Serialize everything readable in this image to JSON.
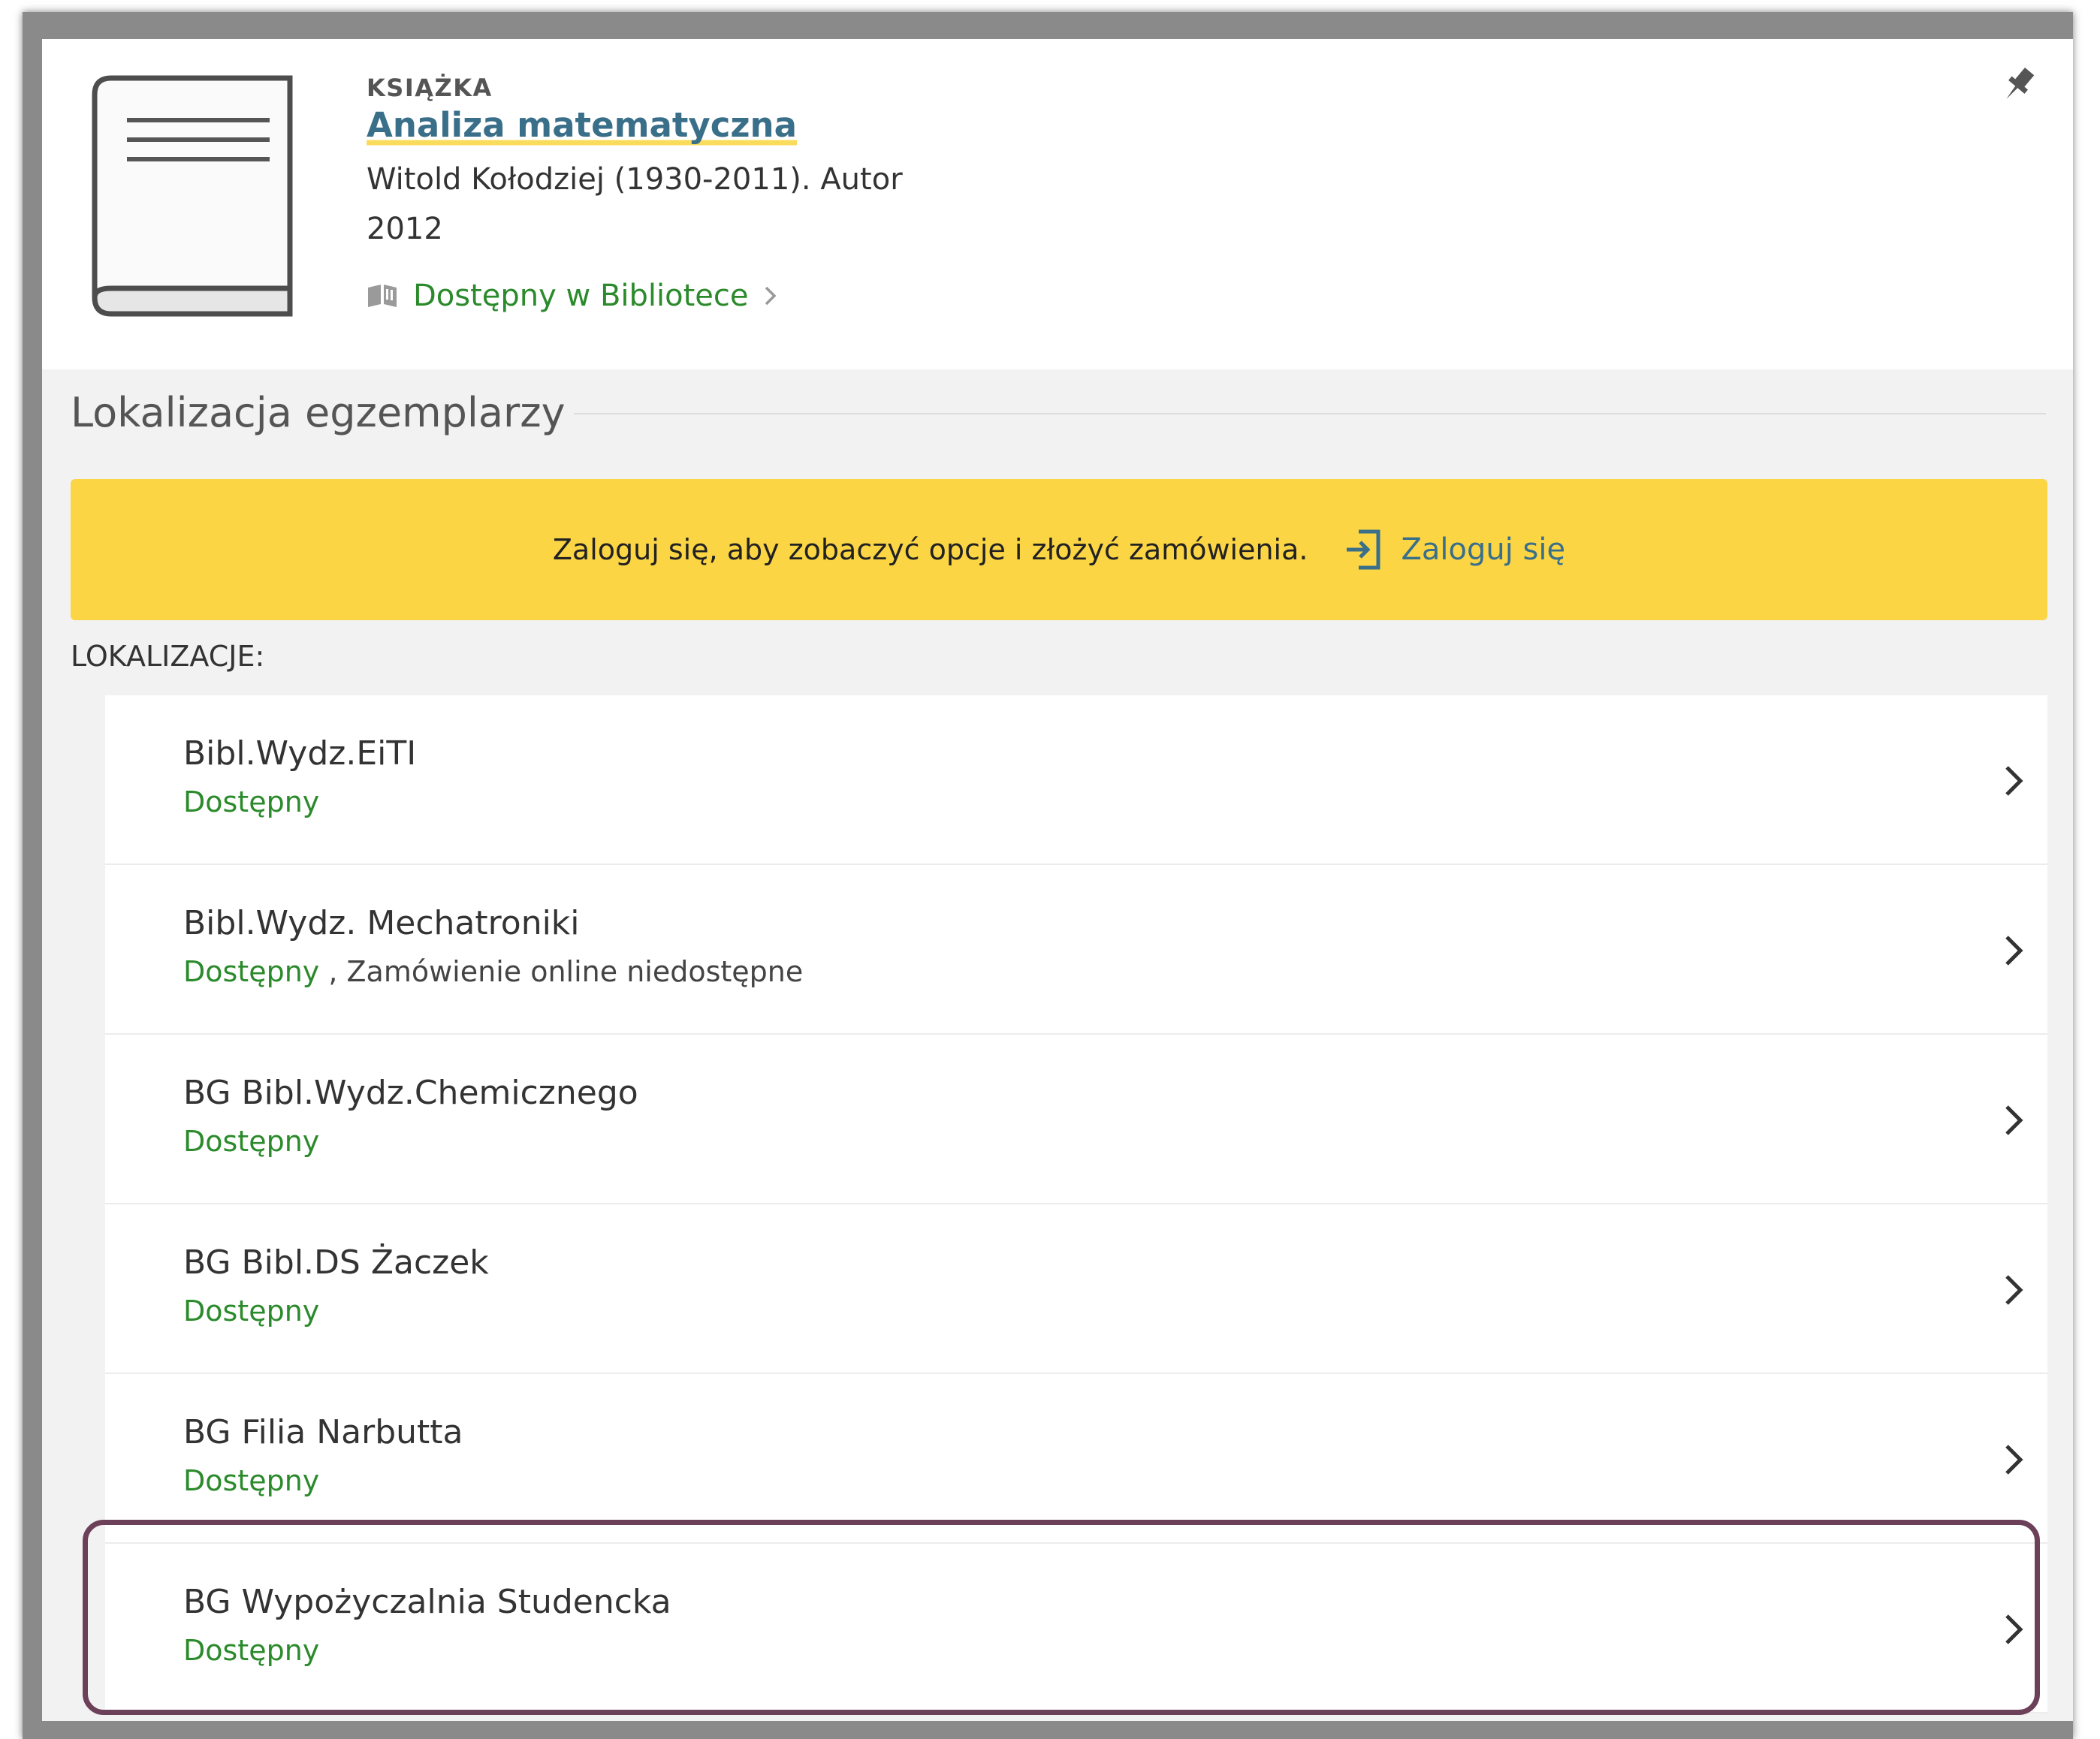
{
  "record": {
    "type": "KSIĄŻKA",
    "title": "Analiza matematyczna",
    "author": "Witold Kołodziej (1930-2011). Autor",
    "year": "2012",
    "availability": "Dostępny w Bibliotece",
    "cover_icon": "book-icon",
    "pin_icon": "pin-icon"
  },
  "section": {
    "title": "Lokalizacja egzemplarzy"
  },
  "banner": {
    "text": "Zaloguj się, aby zobaczyć opcje i złożyć zamówienia.",
    "login_label": "Zaloguj się",
    "login_icon": "sign-in-icon",
    "color": "#fcd545"
  },
  "locations": {
    "heading": "LOKALIZACJE:",
    "items": [
      {
        "name": "Bibl.Wydz.EiTI",
        "status": "Dostępny",
        "note": ""
      },
      {
        "name": "Bibl.Wydz. Mechatroniki",
        "status": "Dostępny",
        "note": " , Zamówienie online niedostępne"
      },
      {
        "name": "BG Bibl.Wydz.Chemicznego",
        "status": "Dostępny",
        "note": ""
      },
      {
        "name": "BG Bibl.DS Żaczek",
        "status": "Dostępny",
        "note": ""
      },
      {
        "name": "BG Filia Narbutta",
        "status": "Dostępny",
        "note": ""
      },
      {
        "name": "BG Wypożyczalnia Studencka",
        "status": "Dostępny",
        "note": ""
      }
    ]
  },
  "colors": {
    "link": "#3a6f8a",
    "available": "#2b8a2b",
    "highlight_border": "#6b4058"
  }
}
